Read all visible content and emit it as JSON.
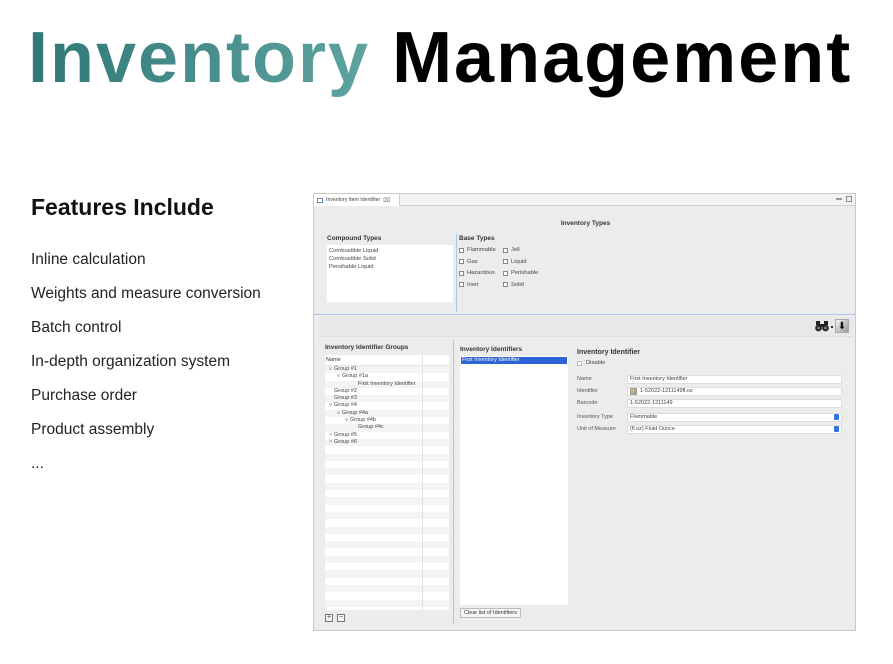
{
  "slide": {
    "title_part1": "Inventory",
    "title_part2": "Management",
    "features_heading": "Features Include",
    "features": [
      "Inline calculation",
      "Weights and measure conversion",
      "Batch control",
      "In-depth organization system",
      "Purchase order",
      "Product assembly",
      "..."
    ]
  },
  "window": {
    "tab_label": "Inventory Item Identifier",
    "tab_close": "⌧",
    "section_title": "Inventory Types",
    "compound": {
      "label": "Compound Types",
      "items": [
        "Combustible Liquid",
        "Combustible Solid",
        "Persihable Liquid"
      ]
    },
    "base": {
      "label": "Base Types",
      "items": [
        "Flammable",
        "Jell",
        "Gas",
        "Liquid",
        "Hazardous",
        "Perishable",
        "Inert",
        "Solid"
      ],
      "checked": [
        false,
        false,
        false,
        false,
        false,
        false,
        false,
        false
      ]
    },
    "toolbar": {
      "search_icon": "binoculars",
      "download_icon": "⬇"
    },
    "groups": {
      "label": "Inventory Identifier Groups",
      "column_header": "Name",
      "rows": [
        {
          "indent": 0,
          "chevron": "∨",
          "label": "Group #1"
        },
        {
          "indent": 1,
          "chevron": "∨",
          "label": "Group #1a"
        },
        {
          "indent": 3,
          "chevron": "",
          "label": "First Inventory Identifier"
        },
        {
          "indent": 0,
          "chevron": "",
          "label": "Group #2"
        },
        {
          "indent": 0,
          "chevron": "",
          "label": "Group #3"
        },
        {
          "indent": 0,
          "chevron": "∨",
          "label": "Group #4"
        },
        {
          "indent": 1,
          "chevron": "∨",
          "label": "Group #4a"
        },
        {
          "indent": 2,
          "chevron": "∨",
          "label": "Group #4b"
        },
        {
          "indent": 3,
          "chevron": "",
          "label": "Group #4c"
        },
        {
          "indent": 0,
          "chevron": ">",
          "label": "Group #5"
        },
        {
          "indent": 0,
          "chevron": ">",
          "label": "Group #6"
        }
      ],
      "add_label": "+",
      "remove_label": "−"
    },
    "identifiers": {
      "label": "Inventory Identifiers",
      "selected": "First Inventory Identifier",
      "clear_label": "Clear list of Identifiers"
    },
    "detail": {
      "title": "Inventory Identifier",
      "disable_label": "Disable",
      "disable_checked": false,
      "name_label": "Name",
      "name_value": "First Inventory Identifier",
      "identifier_label": "Identifier",
      "identifier_value": "1-52022-1211149fl.oz",
      "barcode_label": "Barcode",
      "barcode_value": "1-52022-1211149",
      "type_label": "Inventory Type",
      "type_value": "Flammable",
      "uom_label": "Unit of Measure",
      "uom_value": "(fl.oz) Fluid Ounce"
    }
  }
}
